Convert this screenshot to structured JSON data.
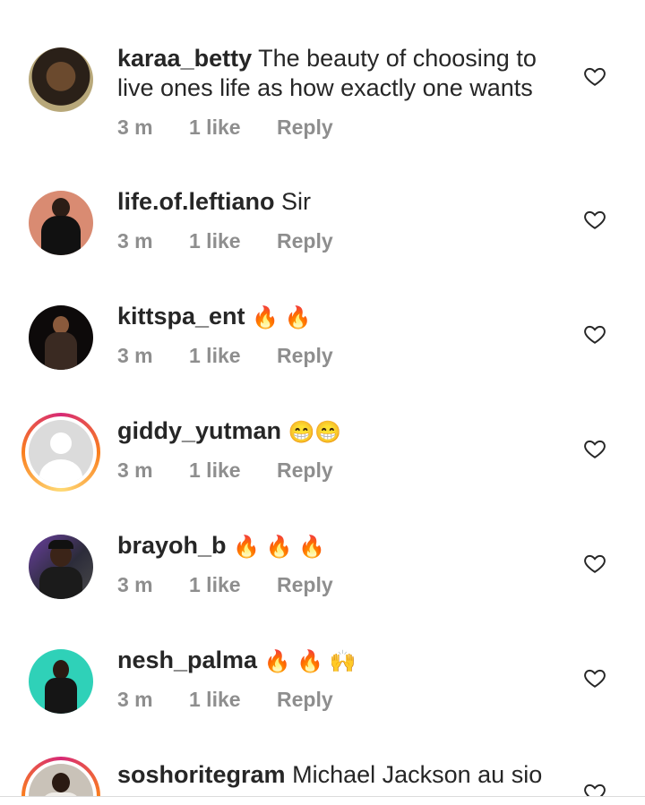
{
  "comments": [
    {
      "username": "karaa_betty",
      "text": "The beauty of choosing to live ones life as how exactly one wants",
      "time": "3 m",
      "likes": "1 like",
      "reply": "Reply"
    },
    {
      "username": "life.of.leftiano",
      "text": "Sir",
      "time": "3 m",
      "likes": "1 like",
      "reply": "Reply"
    },
    {
      "username": "kittspa_ent",
      "text": "🔥 🔥",
      "time": "3 m",
      "likes": "1 like",
      "reply": "Reply"
    },
    {
      "username": "giddy_yutman",
      "text": "😁😁",
      "time": "3 m",
      "likes": "1 like",
      "reply": "Reply"
    },
    {
      "username": "brayoh_b",
      "text": "🔥 🔥 🔥",
      "time": "3 m",
      "likes": "1 like",
      "reply": "Reply"
    },
    {
      "username": "nesh_palma",
      "text": "🔥 🔥 🙌",
      "time": "3 m",
      "likes": "1 like",
      "reply": "Reply"
    },
    {
      "username": "soshoritegram",
      "text": "Michael Jackson au sio",
      "time": "",
      "likes": "",
      "reply": ""
    }
  ],
  "icons": {
    "like": "heart-outline-icon"
  },
  "colors": {
    "text": "#262626",
    "meta": "#8e8e8e",
    "story_ring": "#d62976"
  }
}
